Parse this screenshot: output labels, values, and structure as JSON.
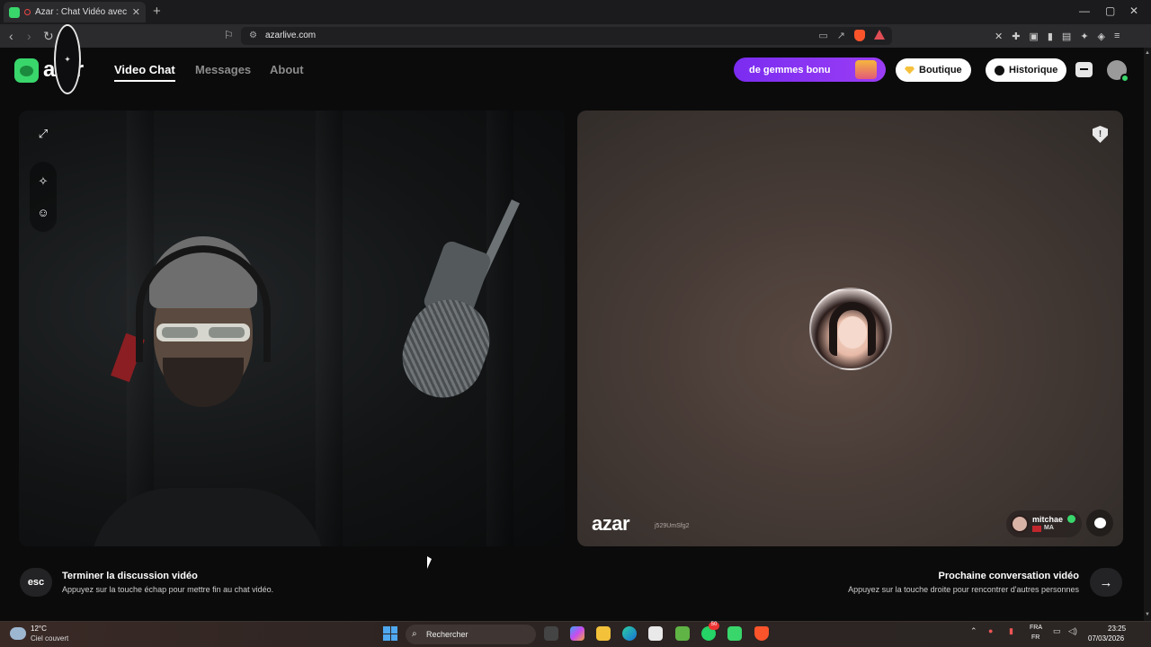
{
  "browser": {
    "tab_title": "Azar : Chat Vidéo avec de no",
    "tab_close": "✕",
    "new_tab": "+",
    "url": "azarlive.com",
    "window_controls": [
      "—",
      "▢",
      "✕"
    ]
  },
  "app": {
    "logo_text": "azar",
    "nav": [
      "Video Chat",
      "Messages",
      "About"
    ],
    "promo_text": "de gemmes bonu",
    "shop_label": "Boutique",
    "history_label": "Historique",
    "accent_color": "#39d66b",
    "promo_color": "#8a34f2"
  },
  "peer": {
    "watermark": "azar",
    "peer_id": "j529UmSfg2",
    "username": "mitchae",
    "country": "MA"
  },
  "footer": {
    "esc_key": "esc",
    "end_title": "Terminer la discussion vidéo",
    "end_hint": "Appuyez sur la touche échap pour mettre fin au chat vidéo.",
    "next_title": "Prochaine conversation vidéo",
    "next_hint": "Appuyez sur la touche droite pour rencontrer d'autres personnes",
    "next_arrow": "→"
  },
  "taskbar": {
    "temperature": "12°C",
    "weather": "Ciel couvert",
    "search_placeholder": "Rechercher",
    "whatsapp_badge": "50",
    "lang_top": "FRA",
    "lang_bottom": "FR",
    "time": "23:25",
    "date": "07/03/2026"
  },
  "icons": {
    "expand": "expand-icon",
    "magic": "magic-wand-icon",
    "sticker": "sticker-icon",
    "report": "report-shield-icon",
    "chat": "chat-bubble-icon"
  }
}
